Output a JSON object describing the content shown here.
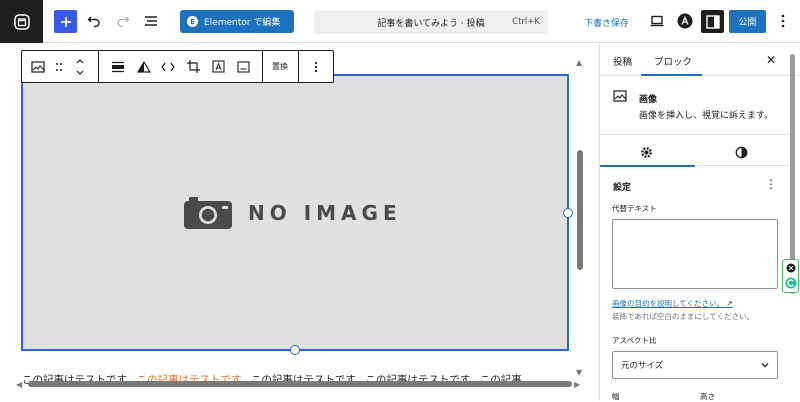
{
  "topbar": {
    "elementor_label": "Elementor で編集",
    "elementor_badge": "E",
    "command_title": "記事を書いてみよう · 投稿",
    "command_shortcut": "Ctrl+K",
    "save_draft_label": "下書き保存",
    "publish_label": "公開",
    "accent_color": "#1e72bd"
  },
  "block_toolbar": {
    "replace_label": "置換"
  },
  "image_block": {
    "placeholder_text": "NO IMAGE"
  },
  "paragraph": {
    "text_1": "この記事はテストです。",
    "text_highlight": "この記事はテストです。",
    "text_2": "この記事はテストです。この記事はテストです。この記事"
  },
  "sidebar": {
    "tabs": [
      "投稿",
      "ブロック"
    ],
    "active_tab": "ブロック",
    "block_title": "画像",
    "block_description": "画像を挿入し、視覚に訴えます。",
    "settings_title": "設定",
    "alt_label": "代替テキスト",
    "alt_value": "",
    "alt_link": "画像の目的を説明してください。",
    "alt_help": "装飾であれば空白のままにしてください。",
    "aspect_label": "アスペクト比",
    "aspect_value": "元のサイズ",
    "width_label": "幅",
    "height_label": "高さ"
  }
}
